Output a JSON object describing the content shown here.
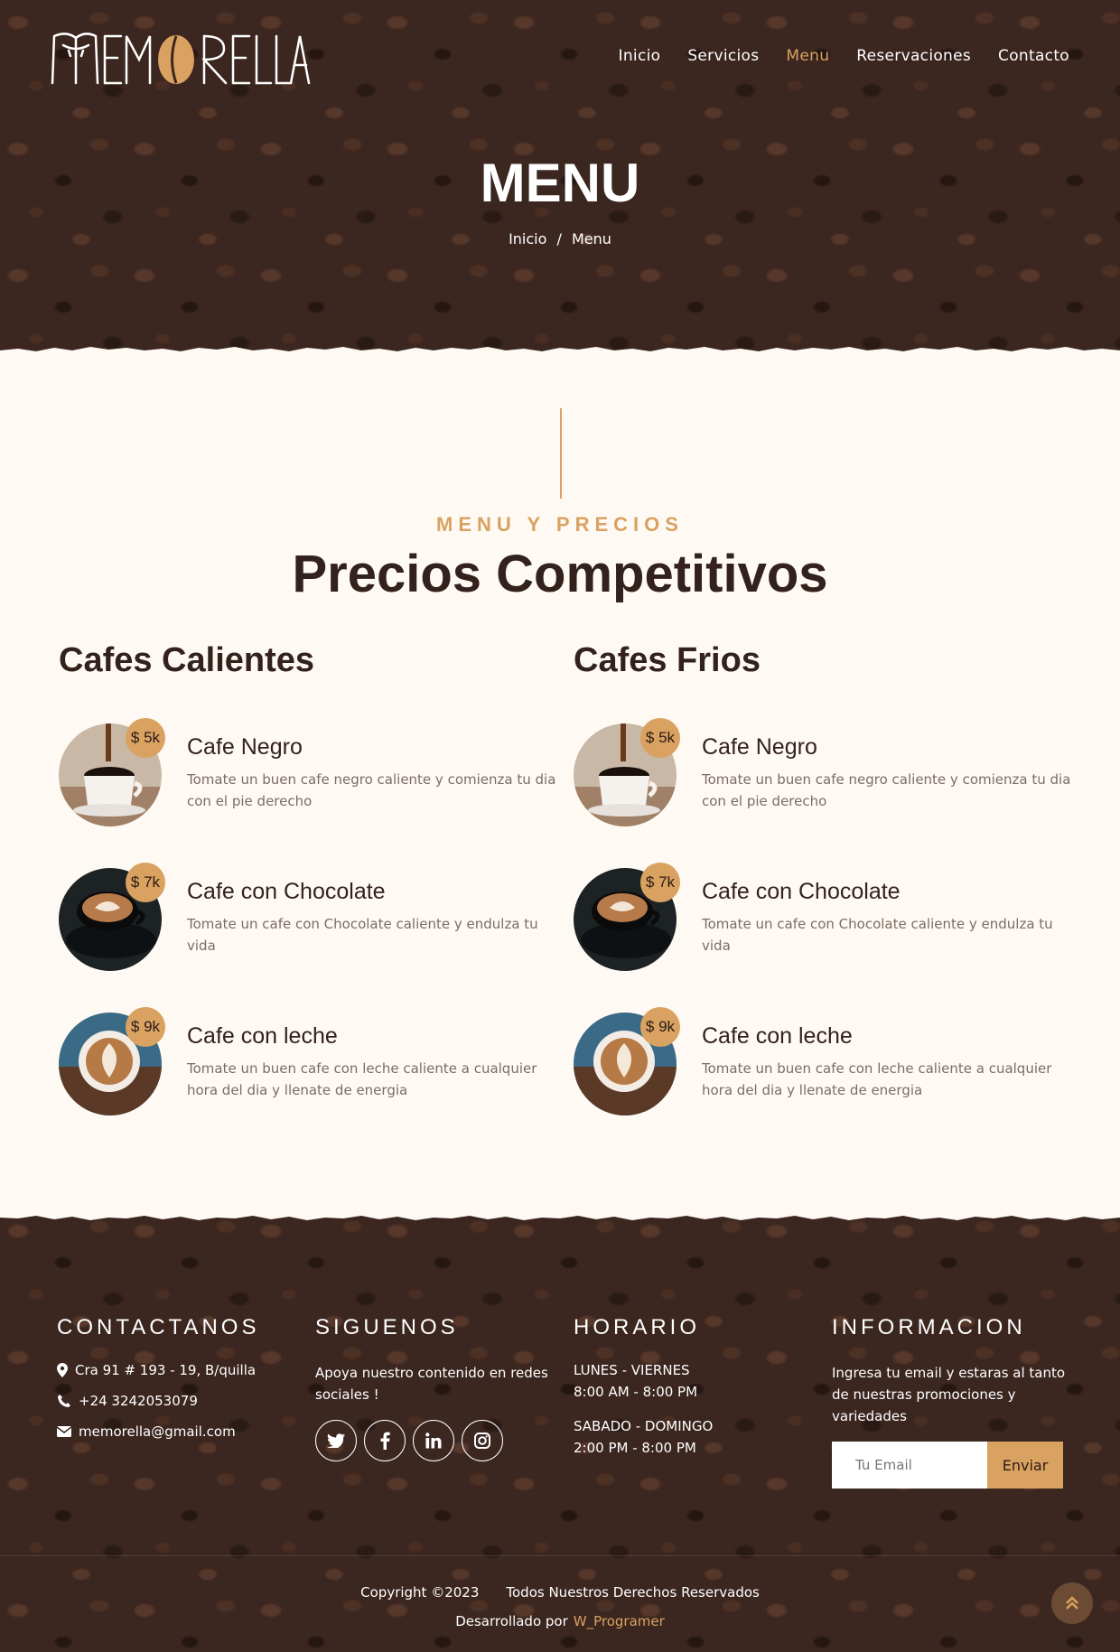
{
  "brand": {
    "logo_text": "MEMORELLA"
  },
  "nav": {
    "items": [
      {
        "label": "Inicio"
      },
      {
        "label": "Servicios"
      },
      {
        "label": "Menu",
        "active": true
      },
      {
        "label": "Reservaciones"
      },
      {
        "label": "Contacto"
      }
    ]
  },
  "hero": {
    "title": "MENU",
    "breadcrumb": {
      "home": "Inicio",
      "separator": "/",
      "current": "Menu"
    }
  },
  "menu": {
    "subtitle": "MENU Y PRECIOS",
    "title": "Precios Competitivos",
    "columns": [
      {
        "heading": "Cafes Calientes",
        "items": [
          {
            "name": "Cafe Negro",
            "price": "$ 5k",
            "description": "Tomate un buen cafe negro caliente y comienza tu dia con el pie derecho",
            "image": "black-coffee-pour"
          },
          {
            "name": "Cafe con Chocolate",
            "price": "$ 7k",
            "description": "Tomate un cafe con Chocolate caliente y endulza tu vida",
            "image": "latte-art-dark-cup"
          },
          {
            "name": "Cafe con leche",
            "price": "$ 9k",
            "description": "Tomate un buen cafe con leche caliente a cualquier hora del dia y llenate de energia",
            "image": "latte-art-table"
          }
        ]
      },
      {
        "heading": "Cafes Frios",
        "items": [
          {
            "name": "Cafe Negro",
            "price": "$ 5k",
            "description": "Tomate un buen cafe negro caliente y comienza tu dia con el pie derecho",
            "image": "black-coffee-pour"
          },
          {
            "name": "Cafe con Chocolate",
            "price": "$ 7k",
            "description": "Tomate un cafe con Chocolate caliente y endulza tu vida",
            "image": "latte-art-dark-cup"
          },
          {
            "name": "Cafe con leche",
            "price": "$ 9k",
            "description": "Tomate un buen cafe con leche caliente a cualquier hora del dia y llenate de energia",
            "image": "latte-art-table"
          }
        ]
      }
    ]
  },
  "footer": {
    "contact": {
      "heading": "CONTACTANOS",
      "address": "Cra 91 # 193 - 19, B/quilla",
      "phone": "+24 3242053079",
      "email": "memorella@gmail.com"
    },
    "social": {
      "heading": "SIGUENOS",
      "text": "Apoya nuestro contenido en redes sociales !",
      "icons": [
        "twitter-icon",
        "facebook-icon",
        "linkedin-icon",
        "instagram-icon"
      ]
    },
    "hours": {
      "heading": "HORARIO",
      "weekday_label": "LUNES - VIERNES",
      "weekday_time": "8:00 AM - 8:00 PM",
      "weekend_label": "SABADO - DOMINGO",
      "weekend_time": "2:00 PM - 8:00 PM"
    },
    "newsletter": {
      "heading": "INFORMACION",
      "text": "Ingresa tu email y estaras al tanto de nuestras promociones y variedades",
      "placeholder": "Tu Email",
      "button": "Enviar"
    },
    "copyright": "Copyright ©2023",
    "rights": "Todos Nuestros Derechos Reservados",
    "developed_by": "Desarrollado por",
    "author": "W_Programer"
  },
  "colors": {
    "accent": "#d9a261",
    "dark": "#33211d",
    "background": "#fefaf3",
    "muted_text": "#7b6b66"
  }
}
